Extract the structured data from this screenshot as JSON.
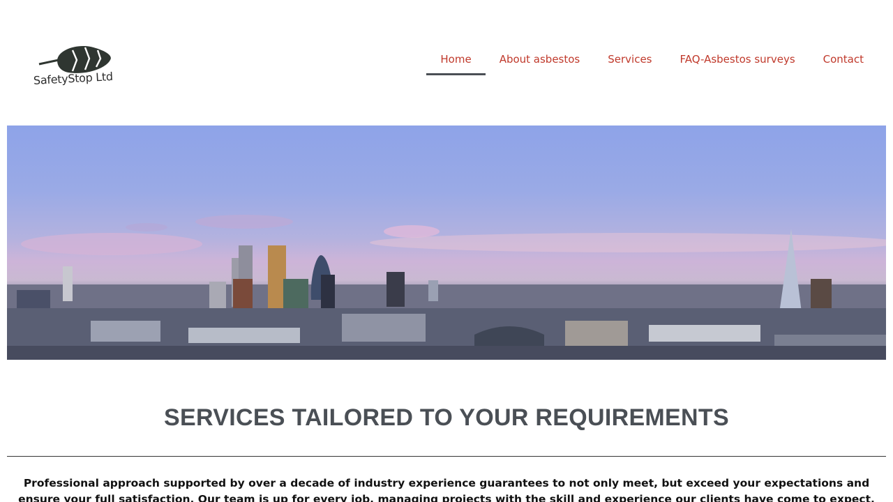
{
  "header": {
    "logo_text": "SafetyStop Ltd"
  },
  "nav": {
    "items": [
      {
        "label": "Home",
        "active": true
      },
      {
        "label": "About asbestos"
      },
      {
        "label": "Services"
      },
      {
        "label": "FAQ-Asbestos surveys"
      },
      {
        "label": "Contact"
      }
    ]
  },
  "main": {
    "title": "SERVICES TAILORED TO YOUR REQUIREMENTS",
    "intro": "Professional approach supported by over a decade of industry experience guarantees to not only meet, but exceed your expectations and ensure your full satisfaction. Our team is up for every job, managing projects with the skill and experience our clients have come to expect. We hold professional"
  },
  "colors": {
    "nav_link": "#c0392b",
    "nav_underline": "#4a4f55",
    "title": "#4a4f55"
  },
  "icons": {
    "logo": "leaf-icon"
  }
}
